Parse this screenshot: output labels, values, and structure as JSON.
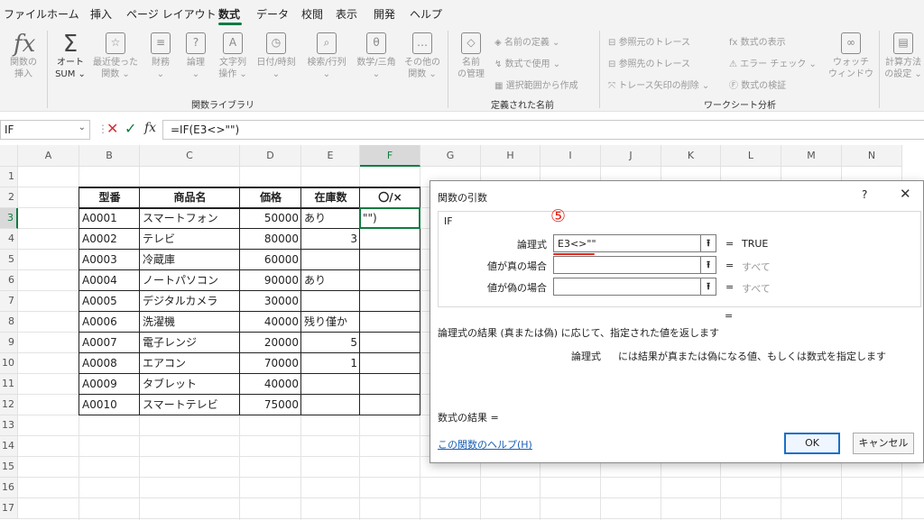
{
  "menu": [
    "ファイル",
    "ホーム",
    "挿入",
    "ページ レイアウト",
    "数式",
    "データ",
    "校閲",
    "表示",
    "開発",
    "ヘルプ"
  ],
  "ribbon": {
    "buttons": [
      {
        "label": "関数の\n挿入",
        "icon": "fx-icon"
      },
      {
        "label": "オート\nSUM ⌄",
        "icon": "sigma-icon"
      },
      {
        "label": "最近使った\n関数 ⌄",
        "icon": "star-icon"
      },
      {
        "label": "財務\n⌄",
        "icon": "db-icon"
      },
      {
        "label": "論理\n⌄",
        "icon": "question-icon"
      },
      {
        "label": "文字列\n操作 ⌄",
        "icon": "text-icon"
      },
      {
        "label": "日付/時刻\n⌄",
        "icon": "clock-icon"
      },
      {
        "label": "検索/行列\n⌄",
        "icon": "search-icon"
      },
      {
        "label": "数学/三角\n⌄",
        "icon": "theta-icon"
      },
      {
        "label": "その他の\n関数 ⌄",
        "icon": "more-icon"
      }
    ],
    "group_function_library": "関数ライブラリ",
    "name_manager": "名前\nの管理",
    "define_name": "名前の定義 ⌄",
    "use_in_formula": "数式で使用 ⌄",
    "create_from_selection": "選択範囲から作成",
    "group_defined_names": "定義された名前",
    "trace_precedents": "参照元のトレース",
    "trace_dependents": "参照先のトレース",
    "remove_arrows": "トレース矢印の削除 ⌄",
    "show_formulas": "数式の表示",
    "error_checking": "エラー チェック ⌄",
    "evaluate_formula": "数式の検証",
    "watch_window": "ウォッチ\nウィンドウ",
    "group_auditing": "ワークシート分析",
    "calc_options": "計算方法\nの設定 ⌄"
  },
  "formula_bar": {
    "name_box": "IF",
    "formula": "=IF(E3<>\"\")"
  },
  "columns": [
    "A",
    "B",
    "C",
    "D",
    "E",
    "F",
    "G",
    "H",
    "I",
    "J",
    "K",
    "L",
    "M",
    "N"
  ],
  "rows": [
    "1",
    "2",
    "3",
    "4",
    "5",
    "6",
    "7",
    "8",
    "9",
    "10",
    "11",
    "12",
    "13",
    "14",
    "15",
    "16",
    "17"
  ],
  "table": {
    "headers": [
      "型番",
      "商品名",
      "価格",
      "在庫数",
      "〇/×"
    ],
    "rows": [
      [
        "A0001",
        "スマートフォン",
        "50000",
        "あり",
        "\"\")"
      ],
      [
        "A0002",
        "テレビ",
        "80000",
        "3",
        ""
      ],
      [
        "A0003",
        "冷蔵庫",
        "60000",
        "",
        ""
      ],
      [
        "A0004",
        "ノートパソコン",
        "90000",
        "あり",
        ""
      ],
      [
        "A0005",
        "デジタルカメラ",
        "30000",
        "",
        ""
      ],
      [
        "A0006",
        "洗濯機",
        "40000",
        "残り僅か",
        ""
      ],
      [
        "A0007",
        "電子レンジ",
        "20000",
        "5",
        ""
      ],
      [
        "A0008",
        "エアコン",
        "70000",
        "1",
        ""
      ],
      [
        "A0009",
        "タブレット",
        "40000",
        "",
        ""
      ],
      [
        "A0010",
        "スマートテレビ",
        "75000",
        "",
        ""
      ]
    ]
  },
  "dialog": {
    "title": "関数の引数",
    "help_q": "?",
    "close": "✕",
    "func": "IF",
    "args": [
      {
        "label": "論理式",
        "value": "E3<>\"\"",
        "result": "TRUE"
      },
      {
        "label": "値が真の場合",
        "value": "",
        "result": "すべて"
      },
      {
        "label": "値が偽の場合",
        "value": "",
        "result": "すべて"
      }
    ],
    "eq": "=",
    "description": "論理式の結果 (真または偽) に応じて、指定された値を返します",
    "arg_desc_name": "論理式",
    "arg_desc": "には結果が真または偽になる値、もしくは数式を指定します",
    "formula_result": "数式の結果 =",
    "help_link": "この関数のヘルプ(H)",
    "ok": "OK",
    "cancel": "キャンセル",
    "annotation": "⑤"
  },
  "colors": {
    "accent": "#107c41",
    "annotation": "#e0281c",
    "link": "#1a5fb4"
  }
}
